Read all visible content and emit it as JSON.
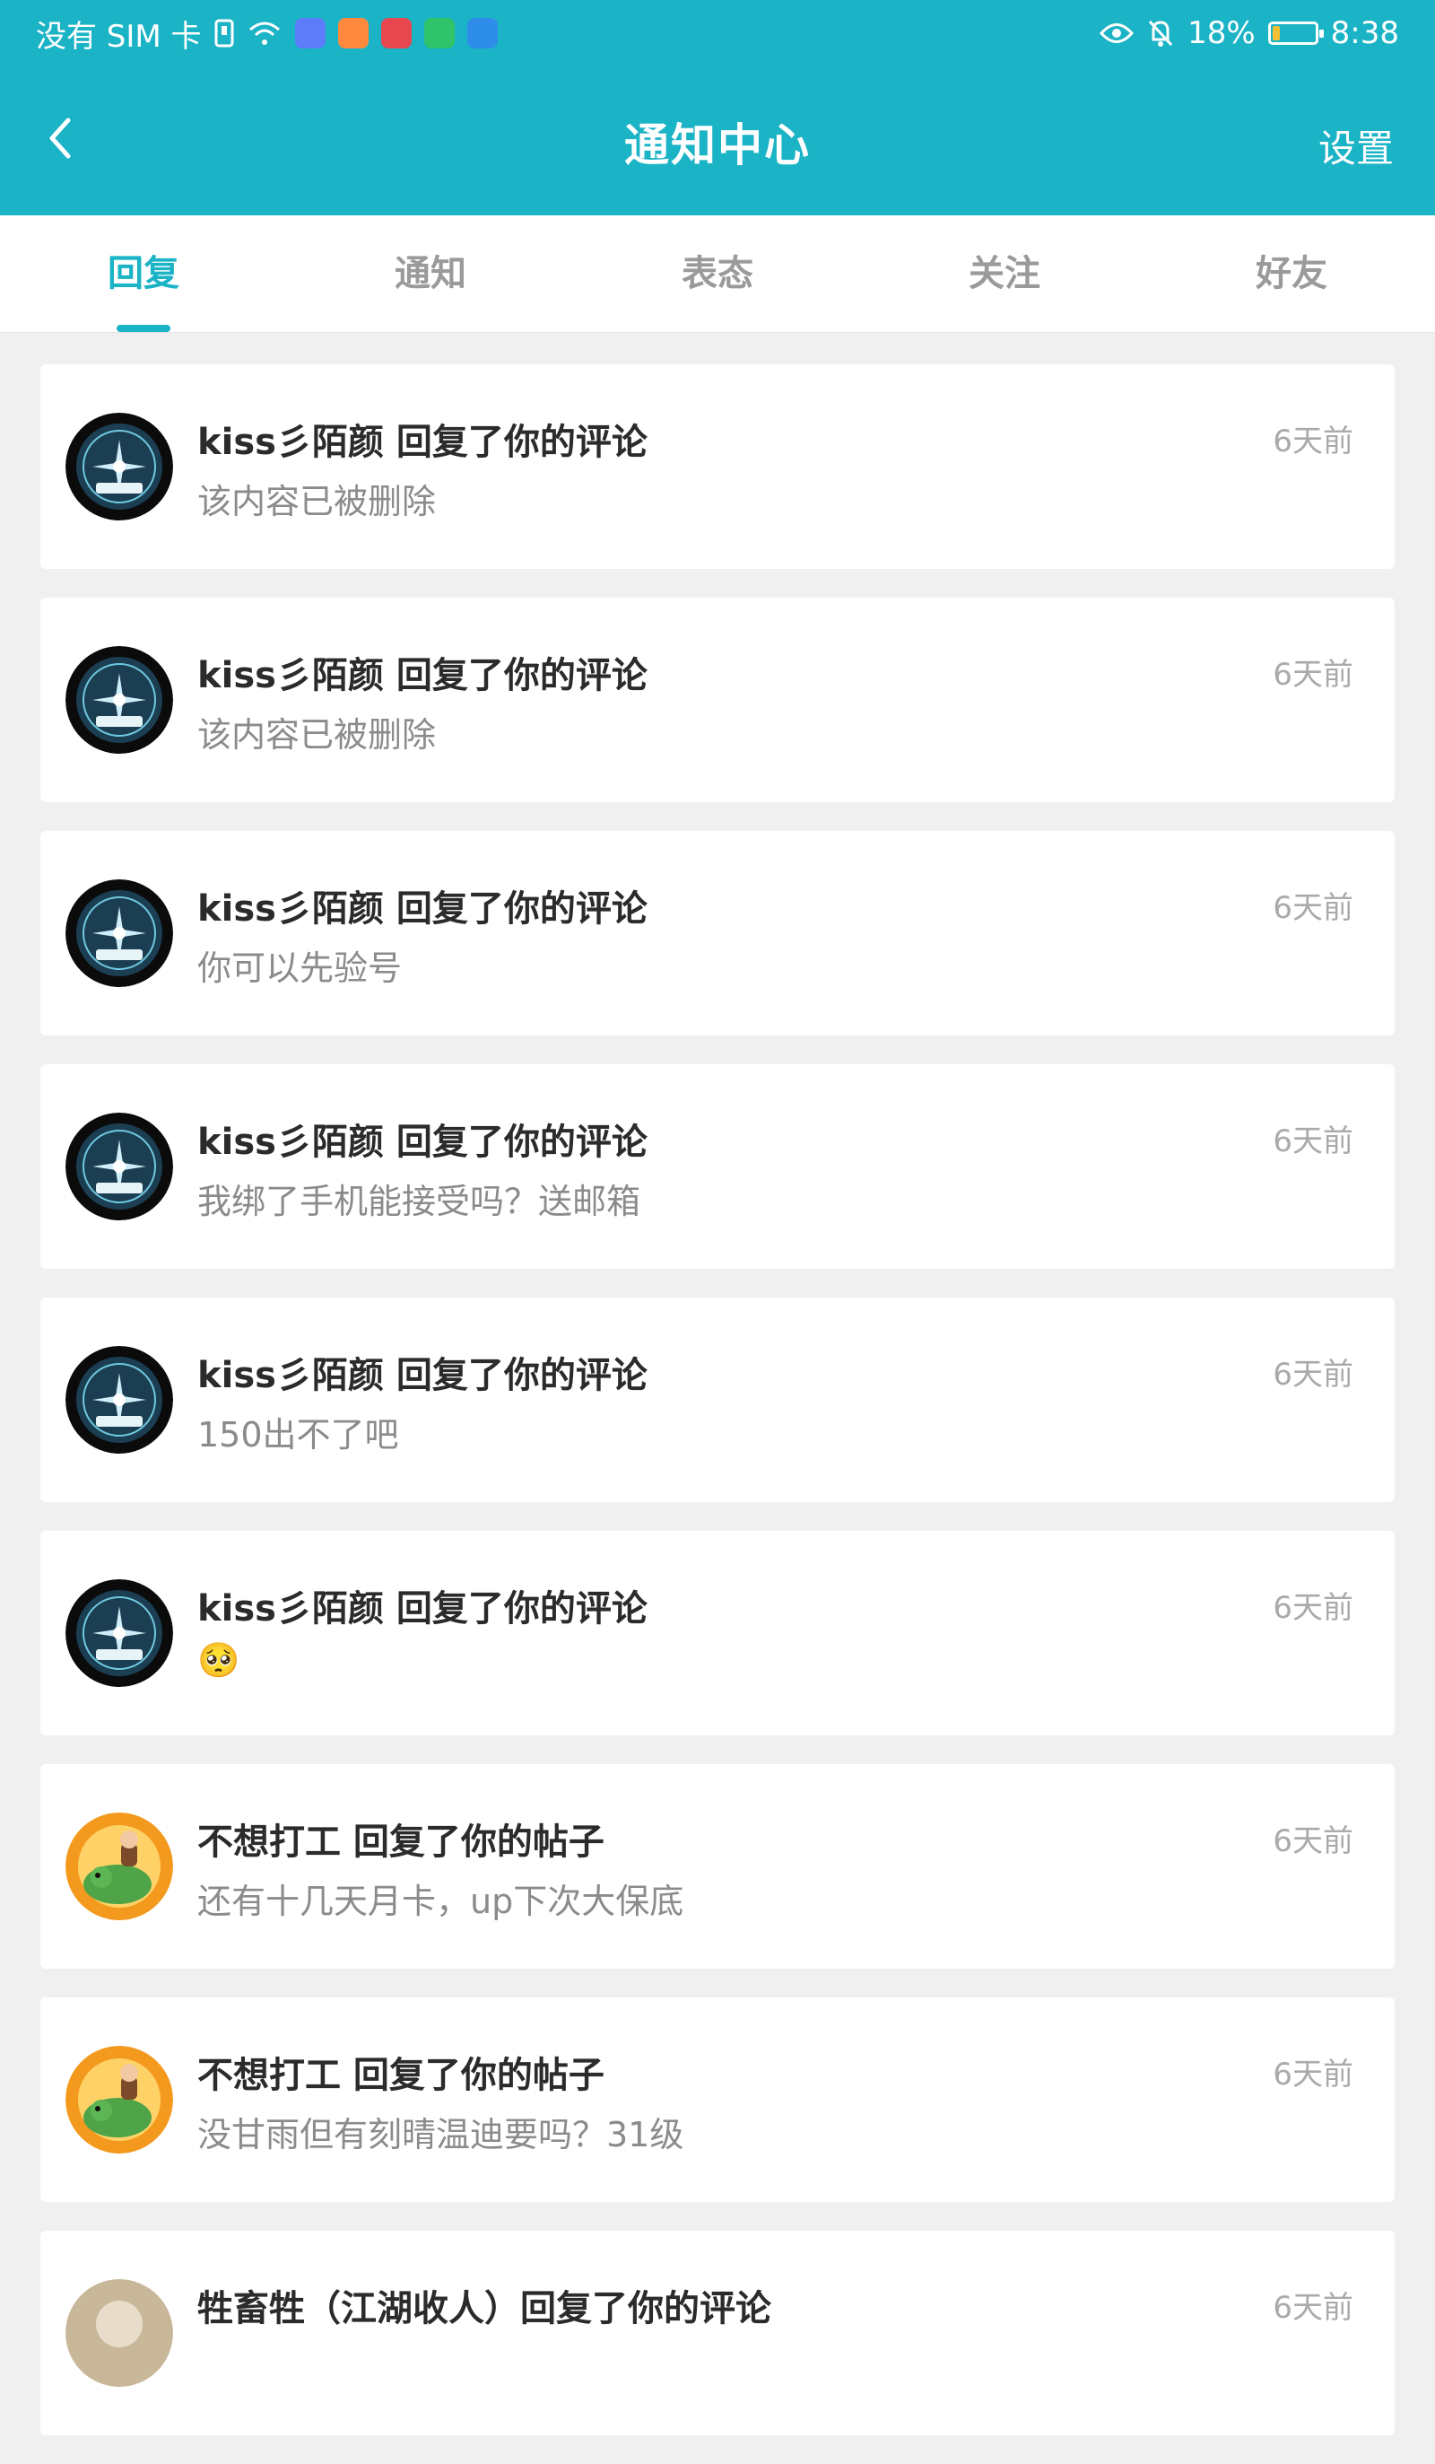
{
  "status_bar": {
    "carrier": "没有 SIM 卡",
    "battery": "18%",
    "battery_level": 0.18,
    "time": "8:38",
    "icons": [
      "sim-icon",
      "wifi-icon",
      "music-app-icon",
      "video-app-icon",
      "book-app-icon",
      "chat-app-icon",
      "browser-app-icon",
      "eye-icon",
      "bell-off-icon",
      "battery-icon"
    ]
  },
  "header": {
    "title": "通知中心",
    "settings_label": "设置"
  },
  "tabs": [
    {
      "label": "回复",
      "active": true
    },
    {
      "label": "通知",
      "active": false
    },
    {
      "label": "表态",
      "active": false
    },
    {
      "label": "关注",
      "active": false
    },
    {
      "label": "好友",
      "active": false
    }
  ],
  "notifications": [
    {
      "title": "kiss彡陌颜 回复了你的评论",
      "content": "该内容已被删除",
      "time": "6天前",
      "avatar": "compass-avatar"
    },
    {
      "title": "kiss彡陌颜 回复了你的评论",
      "content": "该内容已被删除",
      "time": "6天前",
      "avatar": "compass-avatar"
    },
    {
      "title": "kiss彡陌颜 回复了你的评论",
      "content": "你可以先验号",
      "time": "6天前",
      "avatar": "compass-avatar"
    },
    {
      "title": "kiss彡陌颜 回复了你的评论",
      "content": "我绑了手机能接受吗？送邮箱",
      "time": "6天前",
      "avatar": "compass-avatar"
    },
    {
      "title": "kiss彡陌颜 回复了你的评论",
      "content": "150出不了吧",
      "time": "6天前",
      "avatar": "compass-avatar"
    },
    {
      "title": "kiss彡陌颜 回复了你的评论",
      "content": "🥺",
      "time": "6天前",
      "avatar": "compass-avatar"
    },
    {
      "title": "不想打工 回复了你的帖子",
      "content": "还有十几天月卡，up下次大保底",
      "time": "6天前",
      "avatar": "dragon-avatar"
    },
    {
      "title": "不想打工 回复了你的帖子",
      "content": "没甘雨但有刻晴温迪要吗？31级",
      "time": "6天前",
      "avatar": "dragon-avatar"
    },
    {
      "title": "牲畜牲（江湖收人）回复了你的评论",
      "content": "",
      "time": "6天前",
      "avatar": "misc-avatar"
    }
  ]
}
